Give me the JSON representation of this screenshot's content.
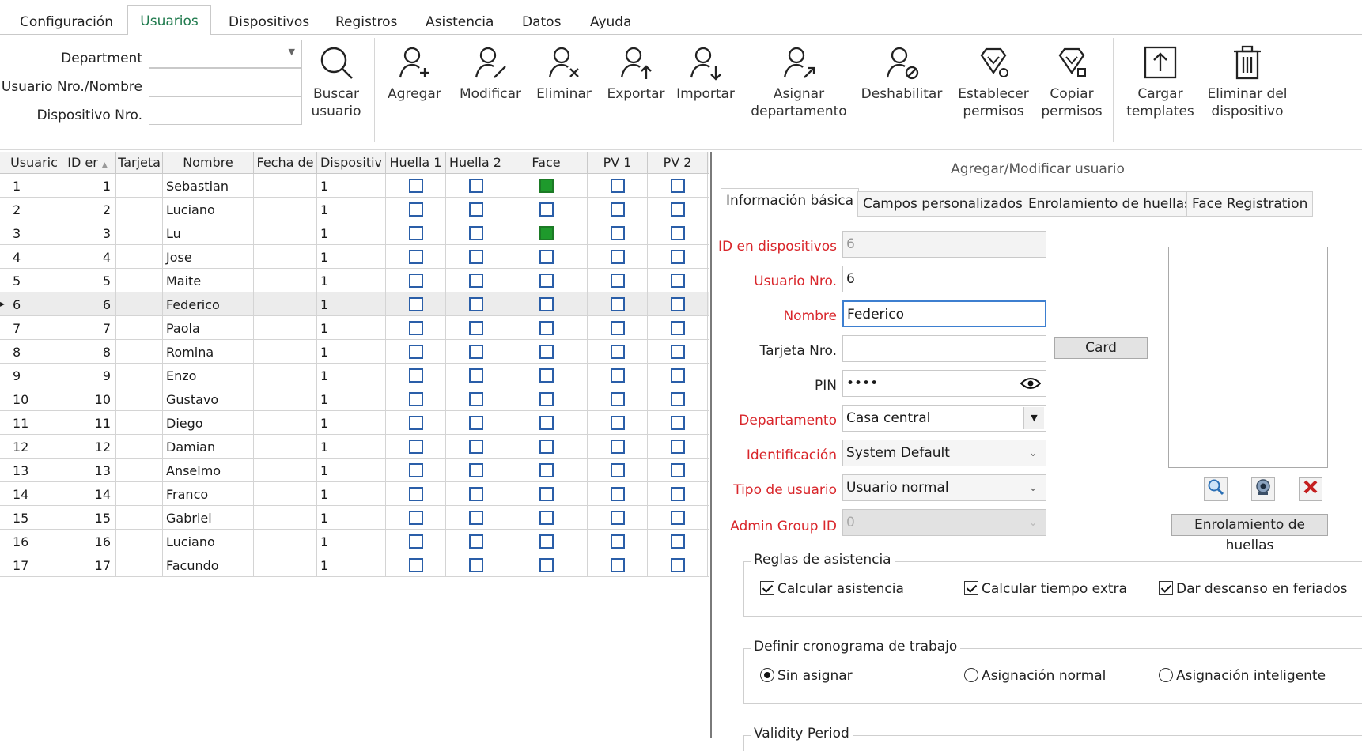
{
  "menu": {
    "tabs": [
      {
        "label": "Configuración"
      },
      {
        "label": "Usuarios"
      },
      {
        "label": "Dispositivos"
      },
      {
        "label": "Registros"
      },
      {
        "label": "Asistencia"
      },
      {
        "label": "Datos"
      },
      {
        "label": "Ayuda"
      }
    ],
    "active": "Usuarios"
  },
  "filters": {
    "department_label": "Department",
    "department_value": "",
    "user_label": "Usuario Nro./Nombre",
    "user_value": "",
    "device_label": "Dispositivo Nro.",
    "device_value": ""
  },
  "toolbar": {
    "search": "Buscar\nusuario",
    "add": "Agregar",
    "modify": "Modificar",
    "delete": "Eliminar",
    "export": "Exportar",
    "import": "Importar",
    "assign_dept": "Asignar\ndepartamento",
    "disable": "Deshabilitar",
    "set_perms": "Establecer\npermisos",
    "copy_perms": "Copiar\npermisos",
    "upload_templates": "Cargar\ntemplates",
    "delete_from_device": "Eliminar del\ndispositivo"
  },
  "grid": {
    "headers": [
      "Usuaric",
      "ID er",
      "Tarjeta",
      "Nombre",
      "Fecha de",
      "Dispositiv",
      "Huella 1",
      "Huella 2",
      "Face",
      "PV 1",
      "PV 2"
    ],
    "sort_indicator": "▲",
    "selected_row_marker": "▸",
    "rows": [
      {
        "usuario": "1",
        "id": "1",
        "tarjeta": "",
        "nombre": "Sebastian",
        "fecha": "",
        "dispositivo": "1",
        "face": true
      },
      {
        "usuario": "2",
        "id": "2",
        "tarjeta": "",
        "nombre": "Luciano",
        "fecha": "",
        "dispositivo": "1",
        "face": false
      },
      {
        "usuario": "3",
        "id": "3",
        "tarjeta": "",
        "nombre": "Lu",
        "fecha": "",
        "dispositivo": "1",
        "face": true
      },
      {
        "usuario": "4",
        "id": "4",
        "tarjeta": "",
        "nombre": "Jose",
        "fecha": "",
        "dispositivo": "1",
        "face": false
      },
      {
        "usuario": "5",
        "id": "5",
        "tarjeta": "",
        "nombre": "Maite",
        "fecha": "",
        "dispositivo": "1",
        "face": false
      },
      {
        "usuario": "6",
        "id": "6",
        "tarjeta": "",
        "nombre": "Federico",
        "fecha": "",
        "dispositivo": "1",
        "face": false
      },
      {
        "usuario": "7",
        "id": "7",
        "tarjeta": "",
        "nombre": "Paola",
        "fecha": "",
        "dispositivo": "1",
        "face": false
      },
      {
        "usuario": "8",
        "id": "8",
        "tarjeta": "",
        "nombre": "Romina",
        "fecha": "",
        "dispositivo": "1",
        "face": false
      },
      {
        "usuario": "9",
        "id": "9",
        "tarjeta": "",
        "nombre": "Enzo",
        "fecha": "",
        "dispositivo": "1",
        "face": false
      },
      {
        "usuario": "10",
        "id": "10",
        "tarjeta": "",
        "nombre": "Gustavo",
        "fecha": "",
        "dispositivo": "1",
        "face": false
      },
      {
        "usuario": "11",
        "id": "11",
        "tarjeta": "",
        "nombre": "Diego",
        "fecha": "",
        "dispositivo": "1",
        "face": false
      },
      {
        "usuario": "12",
        "id": "12",
        "tarjeta": "",
        "nombre": "Damian",
        "fecha": "",
        "dispositivo": "1",
        "face": false
      },
      {
        "usuario": "13",
        "id": "13",
        "tarjeta": "",
        "nombre": "Anselmo",
        "fecha": "",
        "dispositivo": "1",
        "face": false
      },
      {
        "usuario": "14",
        "id": "14",
        "tarjeta": "",
        "nombre": "Franco",
        "fecha": "",
        "dispositivo": "1",
        "face": false
      },
      {
        "usuario": "15",
        "id": "15",
        "tarjeta": "",
        "nombre": "Gabriel",
        "fecha": "",
        "dispositivo": "1",
        "face": false
      },
      {
        "usuario": "16",
        "id": "16",
        "tarjeta": "",
        "nombre": "Luciano",
        "fecha": "",
        "dispositivo": "1",
        "face": false
      },
      {
        "usuario": "17",
        "id": "17",
        "tarjeta": "",
        "nombre": "Facundo",
        "fecha": "",
        "dispositivo": "1",
        "face": false
      }
    ],
    "selected_row": 5
  },
  "panel": {
    "title": "Agregar/Modificar usuario",
    "tabs": [
      {
        "label": "Información básica"
      },
      {
        "label": "Campos personalizados"
      },
      {
        "label": "Enrolamiento de huellas"
      },
      {
        "label": "Face Registration"
      }
    ],
    "fields": {
      "device_id_label": "ID en dispositivos",
      "device_id_value": "6",
      "user_no_label": "Usuario Nro.",
      "user_no_value": "6",
      "name_label": "Nombre",
      "name_value": "Federico",
      "card_label": "Tarjeta Nro.",
      "card_value": "",
      "card_button": "Card",
      "pin_label": "PIN",
      "pin_value": "••••",
      "department_label": "Departamento",
      "department_value": "Casa central",
      "identification_label": "Identificación",
      "identification_value": "System Default",
      "user_type_label": "Tipo de usuario",
      "user_type_value": "Usuario normal",
      "admin_group_label": "Admin Group ID",
      "admin_group_value": "0"
    },
    "enroll_button": "Enrolamiento de huellas",
    "attendance": {
      "title": "Reglas de asistencia",
      "calc_attendance": "Calcular asistencia",
      "calc_overtime": "Calcular tiempo extra",
      "holiday_rest": "Dar descanso en feriados"
    },
    "schedule": {
      "title": "Definir cronograma de trabajo",
      "unassigned": "Sin asignar",
      "normal": "Asignación normal",
      "smart": "Asignación inteligente"
    },
    "validity": {
      "title": "Validity Period"
    }
  },
  "colors": {
    "accent": "#1f7a4d",
    "required": "#d9262b",
    "face_on": "#1e9a2c",
    "checkbox_border": "#2a5ea8"
  }
}
